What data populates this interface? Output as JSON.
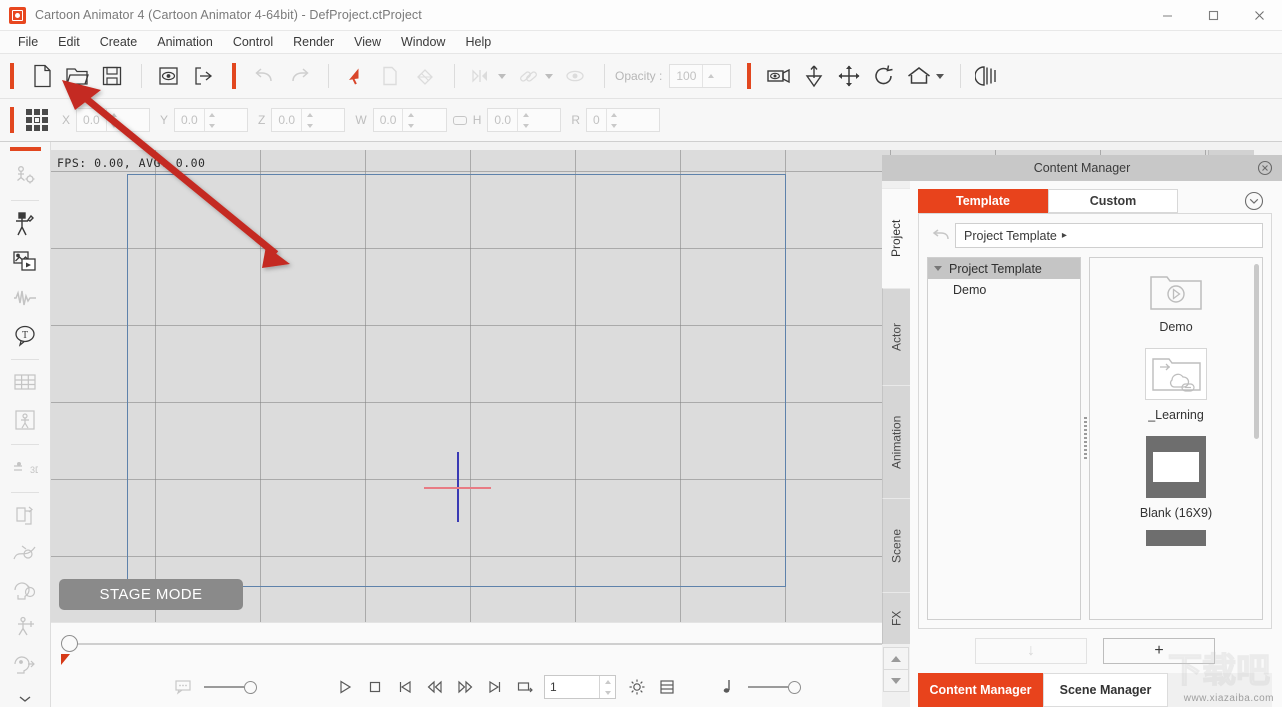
{
  "window": {
    "title": "Cartoon Animator 4  (Cartoon Animator 4-64bit) - DefProject.ctProject",
    "app_icon": "cartoon-animator-logo",
    "minimize": "–",
    "maximize": "□",
    "close": "✕"
  },
  "menu": {
    "items": [
      "File",
      "Edit",
      "Create",
      "Animation",
      "Control",
      "Render",
      "View",
      "Window",
      "Help"
    ]
  },
  "toolbar": {
    "icons": [
      {
        "name": "new-project-icon",
        "label": "New"
      },
      {
        "name": "open-project-icon",
        "label": "Open"
      },
      {
        "name": "save-project-icon",
        "label": "Save"
      },
      {
        "name": "preview-icon",
        "label": "Preview"
      },
      {
        "name": "export-icon",
        "label": "Export"
      },
      {
        "name": "undo-icon",
        "label": "Undo"
      },
      {
        "name": "redo-icon",
        "label": "Redo"
      },
      {
        "name": "select-arrow-icon",
        "label": "Select"
      },
      {
        "name": "copy-icon",
        "label": "Copy"
      },
      {
        "name": "fill-icon",
        "label": "Fill"
      },
      {
        "name": "align-icon",
        "label": "Align"
      },
      {
        "name": "link-icon",
        "label": "Link"
      },
      {
        "name": "visibility-eye-icon",
        "label": "Visibility"
      },
      {
        "name": "camera-icon",
        "label": "Camera"
      },
      {
        "name": "pin-icon",
        "label": "Pin"
      },
      {
        "name": "move-icon",
        "label": "Move"
      },
      {
        "name": "rotate-icon",
        "label": "Rotate"
      },
      {
        "name": "home-icon",
        "label": "Home"
      },
      {
        "name": "onion-skin-icon",
        "label": "Onion Skin"
      }
    ],
    "opacity_label": "Opacity :",
    "opacity_value": "100"
  },
  "transform_bar": {
    "fields": [
      {
        "label": "X",
        "value": "0.0"
      },
      {
        "label": "Y",
        "value": "0.0"
      },
      {
        "label": "Z",
        "value": "0.0"
      },
      {
        "label": "W",
        "value": "0.0"
      },
      {
        "label": "H",
        "value": "0.0"
      },
      {
        "label": "R",
        "value": "0"
      }
    ]
  },
  "left_rail": {
    "items": [
      {
        "name": "composer-icon",
        "state": "disabled"
      },
      {
        "name": "actor-puppet-icon",
        "state": "active"
      },
      {
        "name": "media-image-icon",
        "state": "active"
      },
      {
        "name": "audio-wave-icon",
        "state": "disabled"
      },
      {
        "name": "text-bubble-icon",
        "state": "active"
      },
      {
        "name": "sprite-table-icon",
        "state": "disabled"
      },
      {
        "name": "character-box-icon",
        "state": "disabled"
      },
      {
        "name": "3d-depth-icon",
        "state": "disabled"
      },
      {
        "name": "transform-layers-icon",
        "state": "disabled"
      },
      {
        "name": "motion-path-icon",
        "state": "disabled"
      },
      {
        "name": "face-puppet-icon",
        "state": "disabled"
      },
      {
        "name": "body-puppet-icon",
        "state": "disabled"
      },
      {
        "name": "head-export-icon",
        "state": "disabled"
      },
      {
        "name": "more-chevron-icon",
        "state": "active"
      }
    ]
  },
  "stage": {
    "fps_text": "FPS: 0.00, AVG: 0.00",
    "mode_label": "STAGE MODE"
  },
  "timeline": {
    "frame_value": "1",
    "controls": [
      {
        "name": "play-button",
        "glyph": "play"
      },
      {
        "name": "stop-button",
        "glyph": "stop"
      },
      {
        "name": "go-to-start-button",
        "glyph": "first"
      },
      {
        "name": "step-backward-button",
        "glyph": "prev"
      },
      {
        "name": "step-forward-button",
        "glyph": "next"
      },
      {
        "name": "go-to-end-button",
        "glyph": "last"
      },
      {
        "name": "loop-button",
        "glyph": "loop"
      }
    ],
    "extra_controls": [
      {
        "name": "render-settings-icon"
      },
      {
        "name": "timeline-list-icon"
      },
      {
        "name": "audio-note-icon"
      },
      {
        "name": "comment-icon"
      }
    ]
  },
  "content_manager": {
    "title": "Content Manager",
    "close_label": "✕",
    "vertical_tabs": [
      {
        "label": "Project",
        "active": true
      },
      {
        "label": "Actor",
        "active": false
      },
      {
        "label": "Animation",
        "active": false
      },
      {
        "label": "Scene",
        "active": false
      },
      {
        "label": "FX",
        "active": false
      }
    ],
    "tabs": [
      {
        "label": "Template",
        "active": true
      },
      {
        "label": "Custom",
        "active": false
      }
    ],
    "expand_icon": "chevron-down-circle-icon",
    "back_icon": "back-arrow-icon",
    "path": "Project Template",
    "path_arrow": "▸",
    "tree": [
      {
        "label": "Project Template",
        "selected": true,
        "expanded": true,
        "level": 0
      },
      {
        "label": "Demo",
        "selected": false,
        "level": 1
      }
    ],
    "thumbnails": [
      {
        "caption": "Demo",
        "kind": "folder-play"
      },
      {
        "caption": "_Learning",
        "kind": "folder-cloud-link"
      },
      {
        "caption": "Blank (16X9)",
        "kind": "blank-canvas"
      },
      {
        "caption": "",
        "kind": "clipped-canvas"
      }
    ],
    "footer_buttons": [
      {
        "name": "download-button",
        "label": "↓",
        "disabled": true
      },
      {
        "name": "add-button",
        "label": "+",
        "disabled": false
      }
    ]
  },
  "bottom_tabs": [
    {
      "label": "Content Manager",
      "active": true
    },
    {
      "label": "Scene Manager",
      "active": false
    }
  ],
  "watermark": {
    "url": "www.xiazaiba.com",
    "logo_text": "下载吧"
  },
  "colors": {
    "accent": "#e8431c",
    "accent_bar": "#e2471f",
    "stage_rect": "#5e82ab",
    "annotation_arrow": "#c42b20",
    "panel_header": "#c8c8c8"
  }
}
